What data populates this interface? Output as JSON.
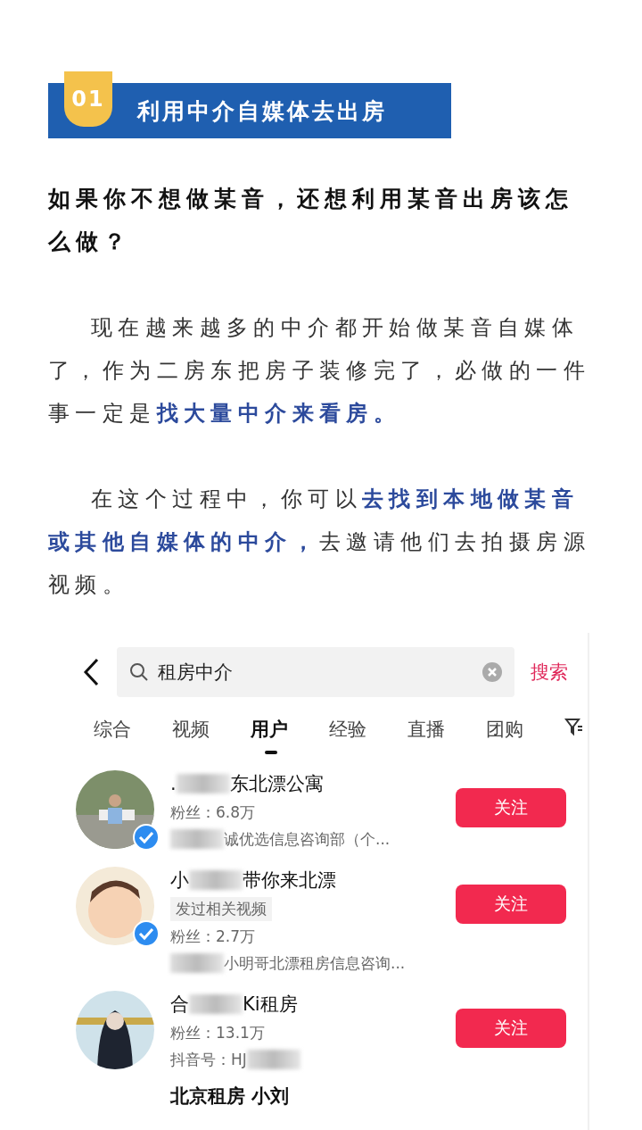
{
  "section": {
    "number": "01",
    "title": "利用中介自媒体去出房"
  },
  "question": "如果你不想做某音，还想利用某音出房该怎么做？",
  "paragraphs": [
    "现在越来越多的中介都开始做某音自媒体了，作为二房东把房子装修完了，必做的一件事一定是**找大量中介来看房。**",
    "在这个过程中，你可以**去找到本地做某音或其他自媒体的中介，**去邀请他们去拍摄房源视频。"
  ],
  "app": {
    "search": {
      "value": "租房中介",
      "button": "搜索"
    },
    "tabs": [
      {
        "label": "综合",
        "selected": false
      },
      {
        "label": "视频",
        "selected": false
      },
      {
        "label": "用户",
        "selected": true
      },
      {
        "label": "经验",
        "selected": false
      },
      {
        "label": "直播",
        "selected": false
      },
      {
        "label": "团购",
        "selected": false
      }
    ],
    "results": [
      {
        "verified": true,
        "avatar": {
          "kind": "picture"
        },
        "name": [
          {
            "kind": "text",
            "text": "."
          },
          {
            "kind": "blur"
          },
          {
            "kind": "text",
            "text": "东北漂公寓"
          }
        ],
        "lines": [
          [
            {
              "kind": "text",
              "text": "粉丝：6.8万"
            }
          ],
          [
            {
              "kind": "blur"
            },
            {
              "kind": "text",
              "text": "诚优选信息咨询部（个..."
            }
          ]
        ],
        "follow": "关注"
      },
      {
        "verified": true,
        "avatar": {
          "kind": "picture"
        },
        "name": [
          {
            "kind": "text",
            "text": "小"
          },
          {
            "kind": "blur"
          },
          {
            "kind": "text",
            "text": "带你来北漂"
          }
        ],
        "tag": "发过相关视频",
        "lines": [
          [
            {
              "kind": "text",
              "text": "粉丝：2.7万"
            }
          ],
          [
            {
              "kind": "blur"
            },
            {
              "kind": "text",
              "text": "小明哥北漂租房信息咨询..."
            }
          ]
        ],
        "follow": "关注"
      },
      {
        "verified": false,
        "avatar": {
          "kind": "picture"
        },
        "name": [
          {
            "kind": "text",
            "text": "合"
          },
          {
            "kind": "blur"
          },
          {
            "kind": "text",
            "text": "Ki租房"
          }
        ],
        "lines": [
          [
            {
              "kind": "text",
              "text": "粉丝：13.1万"
            }
          ],
          [
            {
              "kind": "text",
              "text": "抖音号：HJ"
            },
            {
              "kind": "blur"
            }
          ]
        ],
        "follow": "关注"
      }
    ],
    "partial_result": "北京租房 小刘"
  }
}
